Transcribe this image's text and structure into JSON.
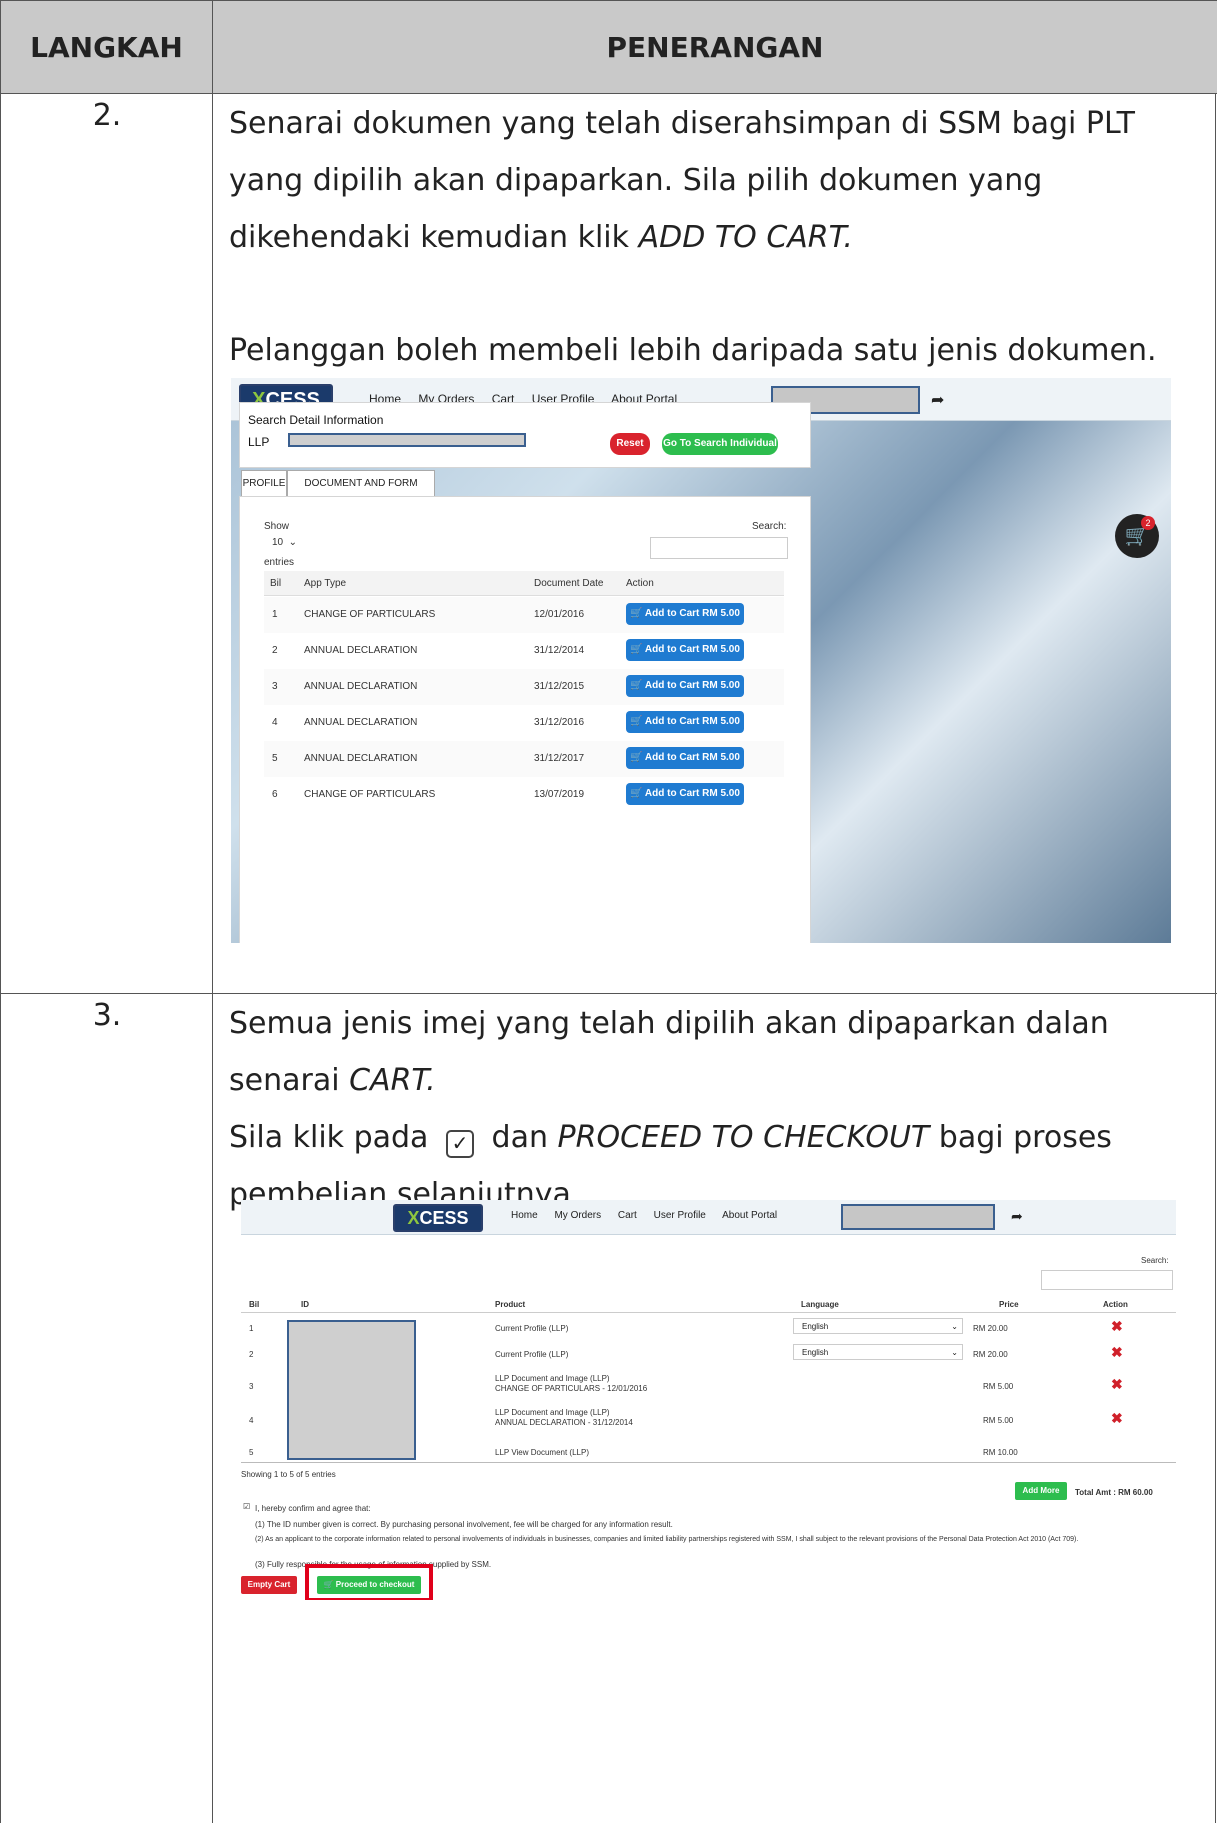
{
  "header": {
    "col1": "LANGKAH",
    "col2": "PENERANGAN"
  },
  "steps": [
    {
      "no": "2.",
      "text_lines": [
        "Senarai dokumen yang telah diserahsimpan di SSM bagi PLT",
        "yang dipilih akan dipaparkan. Sila pilih dokumen yang",
        "dikehendaki kemudian klik"
      ],
      "text_em": "ADD TO CART.",
      "text2": "Pelanggan boleh membeli lebih daripada satu jenis dokumen."
    },
    {
      "no": "3.",
      "line1": "Semua jenis imej yang telah dipilih akan dipaparkan dalan",
      "line2_pre": "senarai",
      "line2_em": "CART.",
      "line3_pre": "Sila klik pada",
      "line3_mid": "dan",
      "line3_em": "PROCEED TO CHECKOUT",
      "line3_post": "bagi proses",
      "line4": "pembelian selanjutnya."
    }
  ],
  "app": {
    "logo": "CESS",
    "logo_x": "X",
    "nav": [
      "Home",
      "My Orders",
      "Cart",
      "User Profile",
      "About Portal"
    ]
  },
  "shot1": {
    "card_title": "Search Detail Information",
    "label": "LLP",
    "reset": "Reset",
    "go": "Go To Search Individual",
    "tabs": [
      "PROFILE",
      "DOCUMENT AND FORM IMAGES"
    ],
    "show": "Show",
    "show_value": "10",
    "entries": "entries",
    "search_label": "Search:",
    "cart_count": "2",
    "columns": [
      "Bil",
      "App Type",
      "Document Date",
      "Action"
    ],
    "rows": [
      {
        "bil": "1",
        "type": "CHANGE OF PARTICULARS",
        "date": "12/01/2016"
      },
      {
        "bil": "2",
        "type": "ANNUAL DECLARATION",
        "date": "31/12/2014"
      },
      {
        "bil": "3",
        "type": "ANNUAL DECLARATION",
        "date": "31/12/2015"
      },
      {
        "bil": "4",
        "type": "ANNUAL DECLARATION",
        "date": "31/12/2016"
      },
      {
        "bil": "5",
        "type": "ANNUAL DECLARATION",
        "date": "31/12/2017"
      },
      {
        "bil": "6",
        "type": "CHANGE OF PARTICULARS",
        "date": "13/07/2019"
      }
    ],
    "add_btn": "Add to Cart RM 5.00"
  },
  "shot2": {
    "search_label": "Search:",
    "columns": [
      "Bil",
      "ID",
      "Product",
      "Language",
      "Price",
      "Action"
    ],
    "rows": [
      {
        "bil": "1",
        "product": "Current Profile (LLP)",
        "product2": "",
        "lang": "English",
        "price": "RM 20.00",
        "x": true
      },
      {
        "bil": "2",
        "product": "Current Profile (LLP)",
        "product2": "",
        "lang": "English",
        "price": "RM 20.00",
        "x": true
      },
      {
        "bil": "3",
        "product": "LLP Document and Image (LLP)",
        "product2": "CHANGE OF PARTICULARS - 12/01/2016",
        "lang": "",
        "price": "RM 5.00",
        "x": true
      },
      {
        "bil": "4",
        "product": "LLP Document and Image (LLP)",
        "product2": "ANNUAL DECLARATION - 31/12/2014",
        "lang": "",
        "price": "RM 5.00",
        "x": true
      },
      {
        "bil": "5",
        "product": "LLP View Document (LLP)",
        "product2": "",
        "lang": "",
        "price": "RM 10.00",
        "x": false
      }
    ],
    "showing": "Showing 1 to 5 of 5 entries",
    "add_more": "Add More",
    "total": "Total Amt : RM 60.00",
    "confirm": "I, hereby confirm and agree that:",
    "terms": [
      "(1) The ID number given is correct. By purchasing personal involvement, fee will be charged for any information result.",
      "(2) As an applicant to the corporate information related to personal involvements of individuals in businesses, companies and limited liability partnerships registered with SSM, I shall subject to the relevant provisions of the Personal Data Protection Act 2010 (Act 709).",
      "(3) Fully responsible for the usage of information supplied by SSM."
    ],
    "empty_cart": "Empty Cart",
    "checkout": "Proceed to checkout"
  }
}
